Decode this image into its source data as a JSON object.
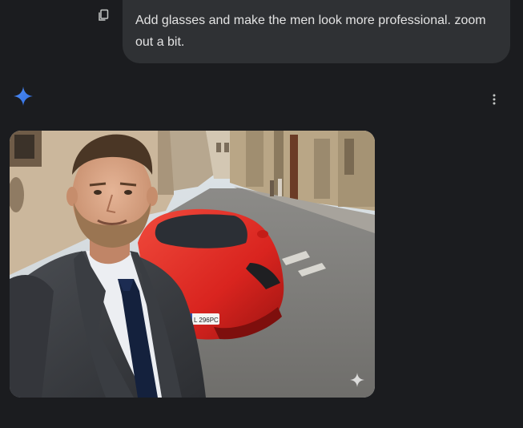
{
  "prompt": {
    "text": "Add glasses and make the men look more professional. zoom out a bit.",
    "copy_icon": "copy-icon"
  },
  "response": {
    "assistant_icon": "sparkle-icon",
    "menu_icon": "more-vert-icon",
    "image": {
      "alt": "Man in a dark suit and navy tie taking a selfie in front of a red sports car on a narrow European street",
      "plate_text": "L 296PC",
      "watermark_icon": "sparkle-watermark-icon"
    }
  },
  "colors": {
    "page_bg": "#1b1c1f",
    "bubble_bg": "#2f3134",
    "text": "#e3e3e3",
    "accent_blue": "#4f8cf7",
    "car_red": "#d9241f"
  }
}
